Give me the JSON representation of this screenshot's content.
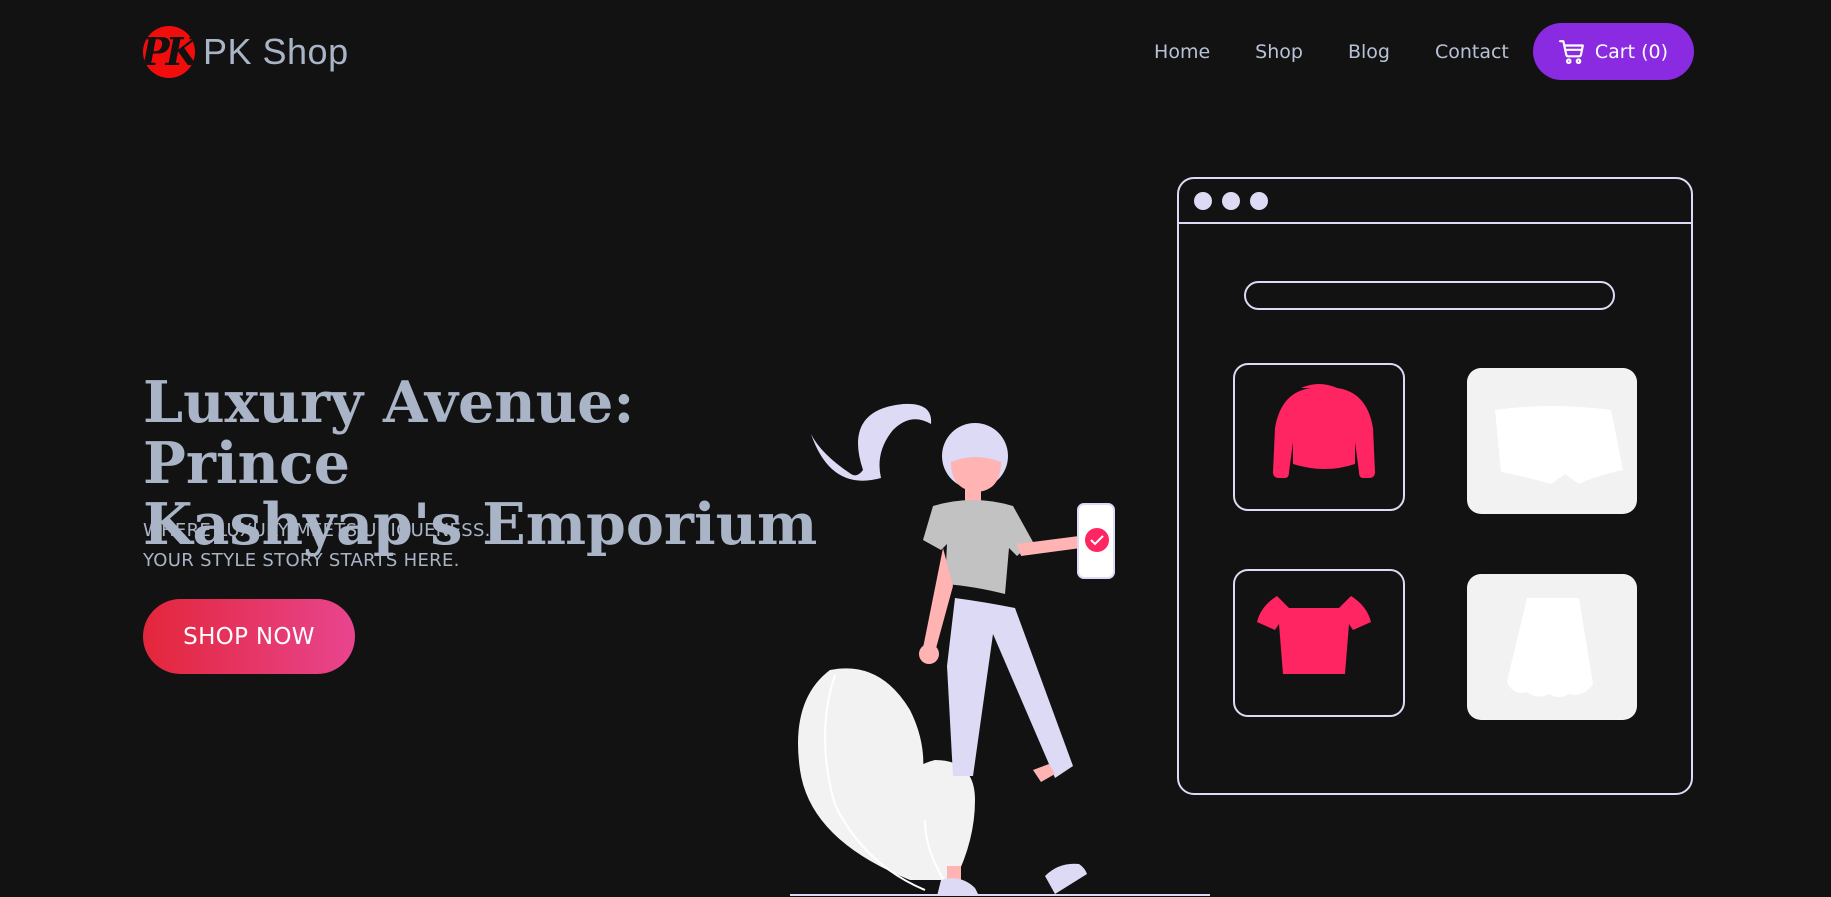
{
  "header": {
    "logo_text": "PK",
    "brand": "PK Shop",
    "nav": [
      {
        "label": "Home"
      },
      {
        "label": "Shop"
      },
      {
        "label": "Blog"
      },
      {
        "label": "Contact"
      }
    ],
    "cart_label": "Cart (0)",
    "cart_icon": "cart-icon"
  },
  "hero": {
    "title_line1": "Luxury Avenue: Prince",
    "title_line2": "Kashyap's Emporium",
    "subtitle_line1": "WHERE LUXURY MEETS UNIQUENESS.",
    "subtitle_line2": "YOUR STYLE STORY STARTS HERE.",
    "cta": "SHOP NOW"
  },
  "colors": {
    "background": "#121212",
    "accent": "#8a2be2",
    "cta_start": "#e3263a",
    "cta_end": "#e8458f",
    "product_pink": "#ff2462",
    "outline": "#dcdaf4"
  }
}
